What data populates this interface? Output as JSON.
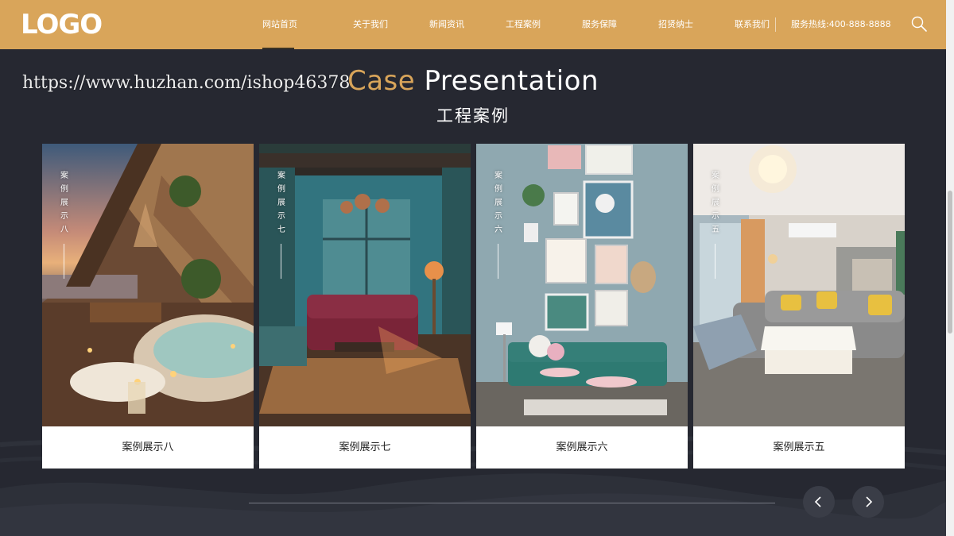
{
  "header": {
    "logo": "LOGO",
    "nav": [
      {
        "label": "网站首页",
        "active": true
      },
      {
        "label": "关于我们"
      },
      {
        "label": "新闻资讯"
      },
      {
        "label": "工程案例"
      },
      {
        "label": "服务保障"
      },
      {
        "label": "招贤纳士"
      },
      {
        "label": "联系我们"
      }
    ],
    "hotline": "服务热线:400-888-8888",
    "search_icon": "search-icon",
    "bg_color": "#d9a55a"
  },
  "section": {
    "title_en_highlight": "Case",
    "title_en_rest": "Presentation",
    "title_cn": "工程案例",
    "accent_color": "#d9a55a",
    "bg_color": "#262831"
  },
  "watermark": "https://www.huzhan.com/ishop46378",
  "cards": [
    {
      "vlabel": "案例展示八",
      "caption": "案例展示八"
    },
    {
      "vlabel": "案例展示七",
      "caption": "案例展示七"
    },
    {
      "vlabel": "案例展示六",
      "caption": "案例展示六"
    },
    {
      "vlabel": "案例展示五",
      "caption": "案例展示五"
    }
  ],
  "controls": {
    "prev_icon": "chevron-left-icon",
    "next_icon": "chevron-right-icon"
  }
}
